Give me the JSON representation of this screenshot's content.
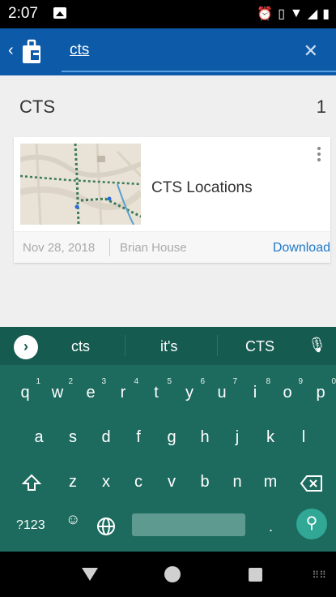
{
  "status_bar": {
    "time": "2:07",
    "icons": [
      "image-icon",
      "alarm-icon",
      "vibrate-icon",
      "wifi-icon",
      "signal-icon",
      "battery-icon"
    ]
  },
  "app_bar": {
    "back_icon": "chevron-left-icon",
    "logo_icon": "app-logo-icon",
    "search_value": "cts",
    "clear_icon": "close-icon",
    "color": "#0d5aa8"
  },
  "results": {
    "group_title": "CTS",
    "group_count": "1",
    "items": [
      {
        "title": "CTS Locations",
        "date": "Nov 28, 2018",
        "author": "Brian House",
        "action": "Download",
        "thumbnail_icon": "map-thumbnail"
      }
    ]
  },
  "keyboard": {
    "suggestions": [
      "cts",
      "it's",
      "CTS"
    ],
    "row1": [
      {
        "k": "q",
        "n": "1"
      },
      {
        "k": "w",
        "n": "2"
      },
      {
        "k": "e",
        "n": "3"
      },
      {
        "k": "r",
        "n": "4"
      },
      {
        "k": "t",
        "n": "5"
      },
      {
        "k": "y",
        "n": "6"
      },
      {
        "k": "u",
        "n": "7"
      },
      {
        "k": "i",
        "n": "8"
      },
      {
        "k": "o",
        "n": "9"
      },
      {
        "k": "p",
        "n": "0"
      }
    ],
    "row2": [
      "a",
      "s",
      "d",
      "f",
      "g",
      "h",
      "j",
      "k",
      "l"
    ],
    "row3": [
      "z",
      "x",
      "c",
      "v",
      "b",
      "n",
      "m"
    ],
    "symbols_label": "?123",
    "period_label": ".",
    "accent_color": "#1d6b5e"
  }
}
